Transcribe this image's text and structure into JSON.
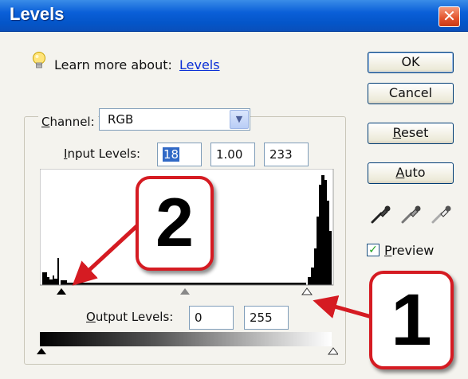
{
  "window": {
    "title": "Levels",
    "close_glyph": "✕"
  },
  "learn_more": {
    "label": "Learn more about:",
    "link": "Levels",
    "icon": "lightbulb-icon"
  },
  "buttons": {
    "ok": "OK",
    "cancel": "Cancel",
    "reset": {
      "pre": "",
      "mnemonic": "R",
      "post": "eset"
    },
    "auto": {
      "pre": "",
      "mnemonic": "A",
      "post": "uto"
    }
  },
  "channel": {
    "pre": "",
    "mnemonic": "C",
    "post": "hannel:",
    "value": "RGB"
  },
  "input_levels": {
    "pre": "",
    "mnemonic": "I",
    "post": "nput Levels:",
    "black": "18",
    "gamma": "1.00",
    "white": "233"
  },
  "output_levels": {
    "pre": "",
    "mnemonic": "O",
    "post": "utput Levels:",
    "black": "0",
    "white": "255"
  },
  "eyedroppers": [
    "black-eyedropper-icon",
    "gray-eyedropper-icon",
    "white-eyedropper-icon"
  ],
  "preview": {
    "pre": "",
    "mnemonic": "P",
    "post": "review",
    "checked": true
  },
  "annotations": {
    "callout_1": "1",
    "callout_2": "2",
    "border_color": "#d51b22",
    "arrow_color": "#d51b22"
  },
  "colors": {
    "titlebar": "#0455c8",
    "dialog_bg": "#f4f3ee",
    "link": "#0b2fd6"
  }
}
